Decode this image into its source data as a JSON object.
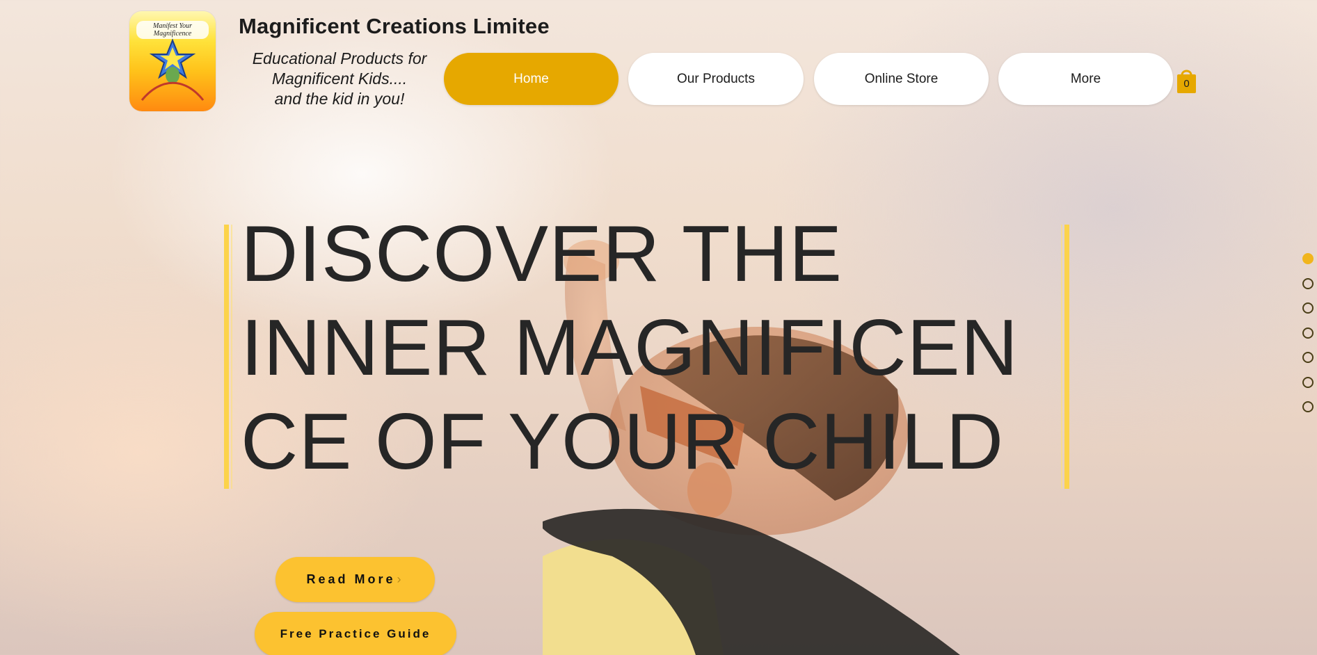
{
  "header": {
    "logo_text": "Manifest Your Magnificence",
    "site_title": "Magnificent Creations Limitee",
    "tagline": [
      "Educational Products for",
      "Magnificent Kids....",
      "and the kid in you!"
    ]
  },
  "nav": {
    "items": [
      {
        "label": "Home",
        "active": true
      },
      {
        "label": "Our Products",
        "active": false
      },
      {
        "label": "Online Store",
        "active": false
      },
      {
        "label": "More",
        "active": false
      }
    ],
    "cart_count": "0"
  },
  "hero": {
    "headline": [
      "DISCOVER THE",
      "INNER MAGNIFICEN",
      "CE OF YOUR CHILD"
    ],
    "read_more_label": "Read More",
    "guide_label": "Free Practice Guide"
  },
  "section_dots": {
    "count": 7,
    "active_index": 0
  },
  "colors": {
    "accent": "#e6a800",
    "button": "#fcc230",
    "bar": "#fcd34a",
    "text": "#262626"
  }
}
